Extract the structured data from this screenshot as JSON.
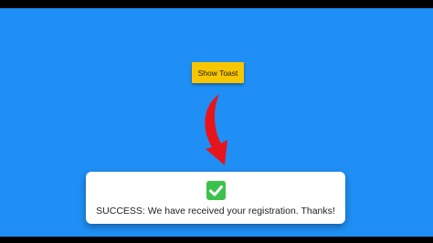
{
  "trigger": {
    "label": "Show Toast"
  },
  "toast": {
    "status": "success",
    "icon": "check-icon",
    "message": "SUCCESS: We have received your registration. Thanks!"
  },
  "colors": {
    "background": "#1f8ff5",
    "button": "#f7c600",
    "arrow": "#e8141b",
    "success_icon": "#3cc24a",
    "toast_background": "#ffffff",
    "letterbox": "#000000"
  }
}
